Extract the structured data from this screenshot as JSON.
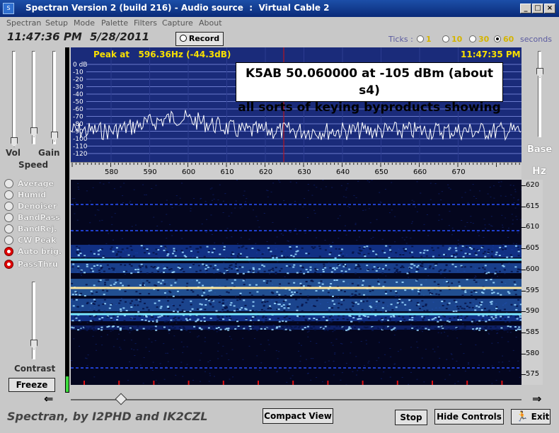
{
  "window": {
    "title": "Spectran Version 2 (build 216) - Audio source  :  Virtual Cable 2",
    "icon": "app-icon",
    "controls": [
      "_",
      "□",
      "×"
    ]
  },
  "menu": [
    "Spectran",
    "Setup",
    "Mode",
    "Palette",
    "Filters",
    "Capture",
    "About"
  ],
  "status": {
    "time": "11:47:36 PM",
    "date": "5/28/2011",
    "record_label": "Record"
  },
  "ticks": {
    "label": "Ticks :",
    "options": [
      "1",
      "10",
      "30",
      "60"
    ],
    "selected": "60",
    "unit": "seconds"
  },
  "left_panel": {
    "vol_label": "Vol",
    "gain_label": "Gain",
    "speed_label": "Speed",
    "options": [
      {
        "label": "Average",
        "on": false
      },
      {
        "label": "Humid",
        "on": false
      },
      {
        "label": "Denoiser",
        "on": false
      },
      {
        "label": "BandPass",
        "on": false
      },
      {
        "label": "BandRej.",
        "on": false
      },
      {
        "label": "CW Peak",
        "on": false
      },
      {
        "label": "Auto brig.",
        "on": true
      },
      {
        "label": "PassThru",
        "on": true
      }
    ],
    "contrast_label": "Contrast",
    "freeze_label": "Freeze"
  },
  "right_panel": {
    "base_label": "Base",
    "hz_label": "Hz"
  },
  "spectrum": {
    "peak_text": "Peak at   596.36Hz (-44.3dB)",
    "time": "11:47:35 PM",
    "db_labels": [
      "0 dB",
      "-10",
      "-20",
      "-30",
      "-40",
      "-50",
      "-60",
      "-70",
      "-80",
      "-90",
      "-100",
      "-110",
      "-120"
    ],
    "freq_labels": [
      "580",
      "590",
      "600",
      "610",
      "620",
      "630",
      "640",
      "650",
      "660",
      "670"
    ],
    "annotation_line1": "K5AB 50.060000 at -105 dBm (about s4)",
    "annotation_line2": "all sorts of keying byproducts showing",
    "colors": {
      "background": "#1a2b7a",
      "trace": "#ffffff",
      "marker": "#d01010"
    }
  },
  "waterfall": {
    "hz_labels": [
      "620",
      "615",
      "610",
      "605",
      "600",
      "595",
      "590",
      "585",
      "580",
      "575"
    ]
  },
  "footer": {
    "credit": "Spectran, by I2PHD and IK2CZL",
    "compact_label": "Compact View",
    "stop_label": "Stop",
    "hide_label": "Hide Controls",
    "exit_label": "Exit"
  }
}
